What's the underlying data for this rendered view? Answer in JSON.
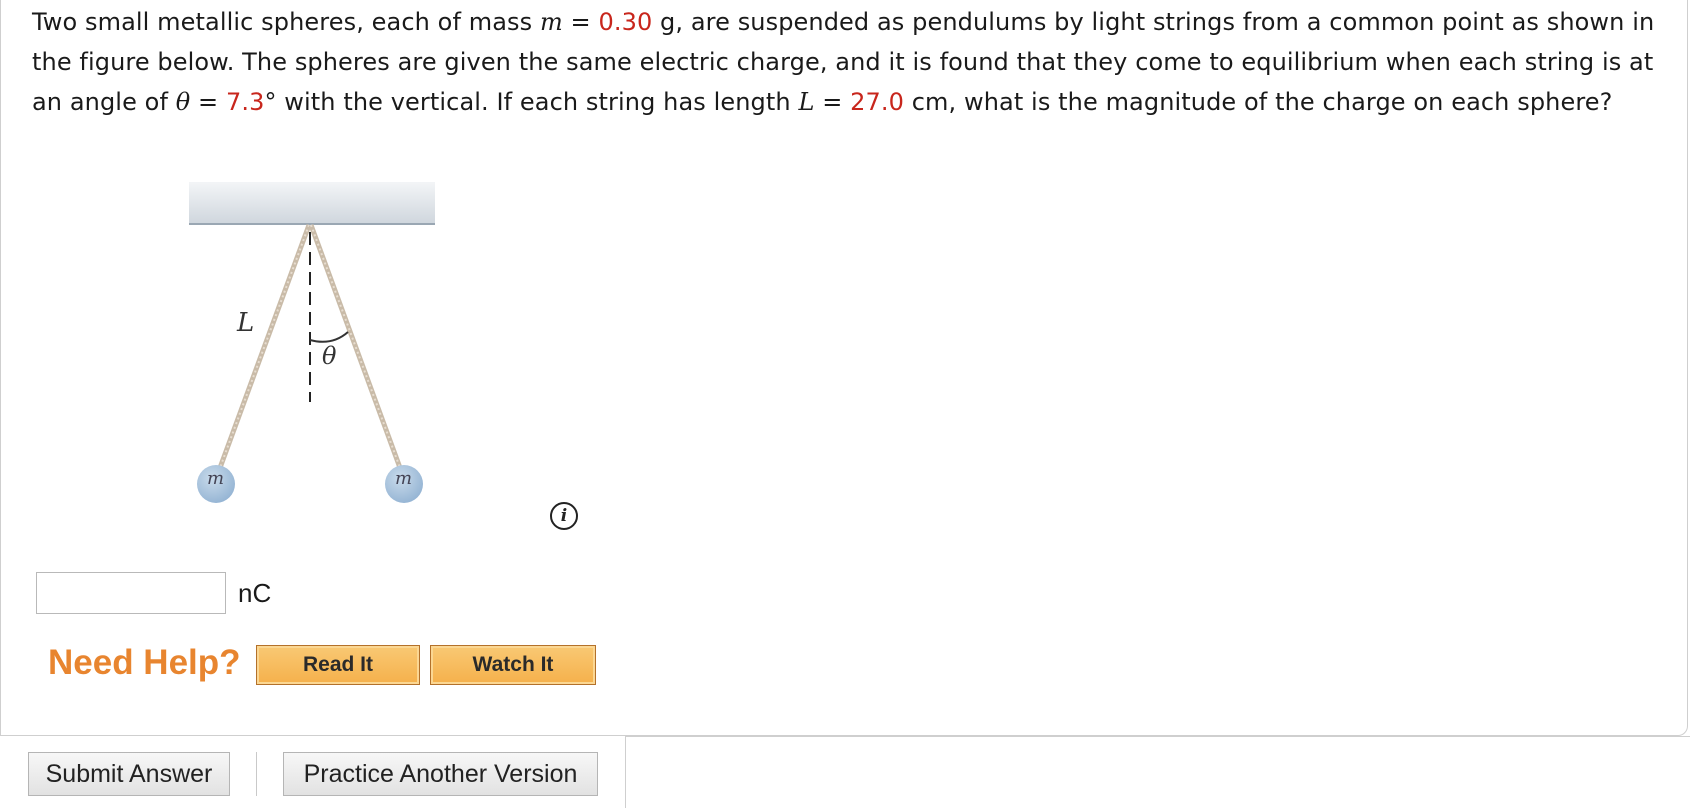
{
  "question": {
    "intro": "Two small metallic spheres, each of mass ",
    "m_symbol": "m",
    "eq1": " = ",
    "mass_value": "0.30",
    "after_mass": " g, are suspended as pendulums by light strings from a common point as shown in the figure below. The spheres are given the same electric charge, and it is found that they come to equilibrium when each string is at an angle of ",
    "theta_symbol": "θ",
    "eq2": " = ",
    "angle_value": "7.3",
    "after_angle": "° with the vertical. If each string has length ",
    "L_symbol": "L",
    "eq3": " = ",
    "length_value": "27.0",
    "after_length": " cm, what is the magnitude of the charge on each sphere?"
  },
  "figure": {
    "length_label": "L",
    "angle_label": "θ",
    "left_mass_label": "m",
    "right_mass_label": "m"
  },
  "info_icon": {
    "glyph": "i",
    "icon": "info-icon"
  },
  "answer": {
    "value": "",
    "unit": "nC"
  },
  "help": {
    "title": "Need Help?",
    "read_label": "Read It",
    "watch_label": "Watch It"
  },
  "actions": {
    "submit_label": "Submit Answer",
    "practice_label": "Practice Another Version"
  },
  "colors": {
    "given_value": "#c8261c",
    "need_help": "#e8852f",
    "help_button": "#f5b04b",
    "sphere": "#a9c4de"
  }
}
